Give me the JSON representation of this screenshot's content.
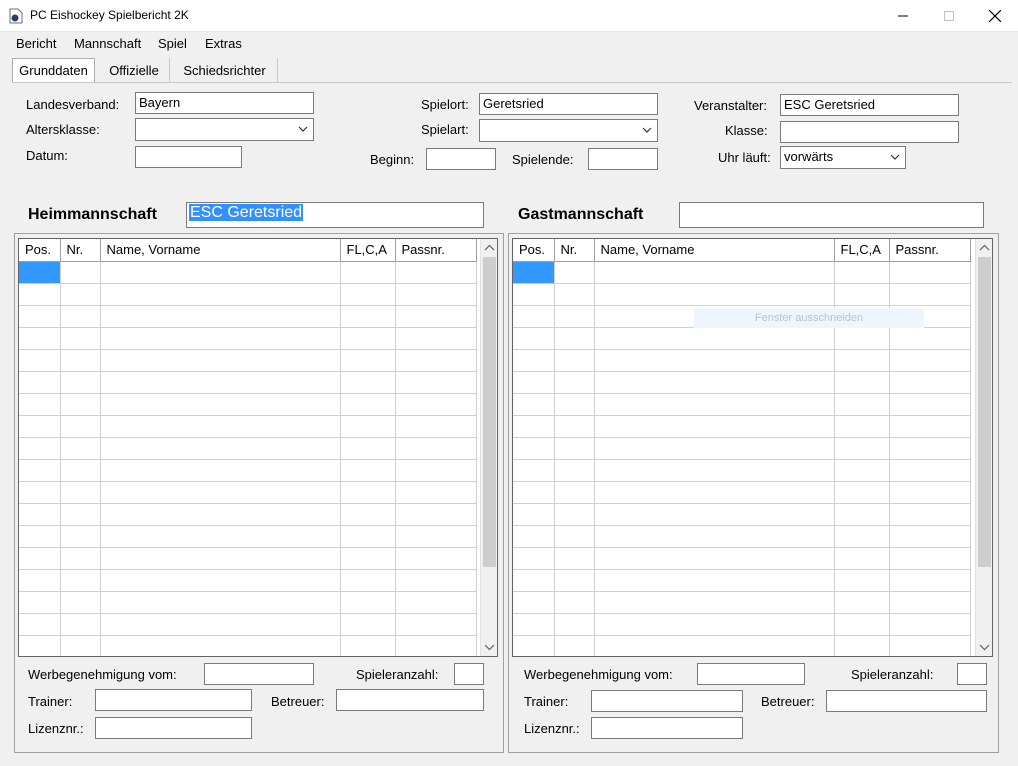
{
  "window": {
    "title": "PC Eishockey Spielbericht 2K"
  },
  "menu": {
    "bericht": "Bericht",
    "mannschaft": "Mannschaft",
    "spiel": "Spiel",
    "extras": "Extras"
  },
  "tabs": {
    "grunddaten": "Grunddaten",
    "offizielle": "Offizielle",
    "schiedsrichter": "Schiedsrichter"
  },
  "form": {
    "landesverband_label": "Landesverband:",
    "landesverband_value": "Bayern",
    "altersklasse_label": "Altersklasse:",
    "altersklasse_value": "",
    "datum_label": "Datum:",
    "datum_value": "",
    "spielort_label": "Spielort:",
    "spielort_value": "Geretsried",
    "spielart_label": "Spielart:",
    "spielart_value": "",
    "beginn_label": "Beginn:",
    "beginn_value": "",
    "spielende_label": "Spielende:",
    "spielende_value": "",
    "veranstalter_label": "Veranstalter:",
    "veranstalter_value": "ESC Geretsried",
    "klasse_label": "Klasse:",
    "klasse_value": "",
    "uhr_label": "Uhr läuft:",
    "uhr_value": "vorwärts"
  },
  "home": {
    "heading": "Heimmannschaft",
    "team_name": "ESC Geretsried",
    "columns": [
      "Pos.",
      "Nr.",
      "Name, Vorname",
      "FL,C,A",
      "Passnr."
    ],
    "werbe_label": "Werbegenehmigung vom:",
    "spieleranzahl_label": "Spieleranzahl:",
    "trainer_label": "Trainer:",
    "betreuer_label": "Betreuer:",
    "lizenz_label": "Lizenznr.:"
  },
  "guest": {
    "heading": "Gastmannschaft",
    "team_name": "",
    "columns": [
      "Pos.",
      "Nr.",
      "Name, Vorname",
      "FL,C,A",
      "Passnr."
    ],
    "werbe_label": "Werbegenehmigung vom:",
    "spieleranzahl_label": "Spieleranzahl:",
    "trainer_label": "Trainer:",
    "betreuer_label": "Betreuer:",
    "lizenz_label": "Lizenznr.:"
  },
  "overlay": {
    "tooltip": "Fenster ausschneiden"
  },
  "colors": {
    "selection": "#3399ff",
    "window_bg": "#f0f0f0"
  }
}
